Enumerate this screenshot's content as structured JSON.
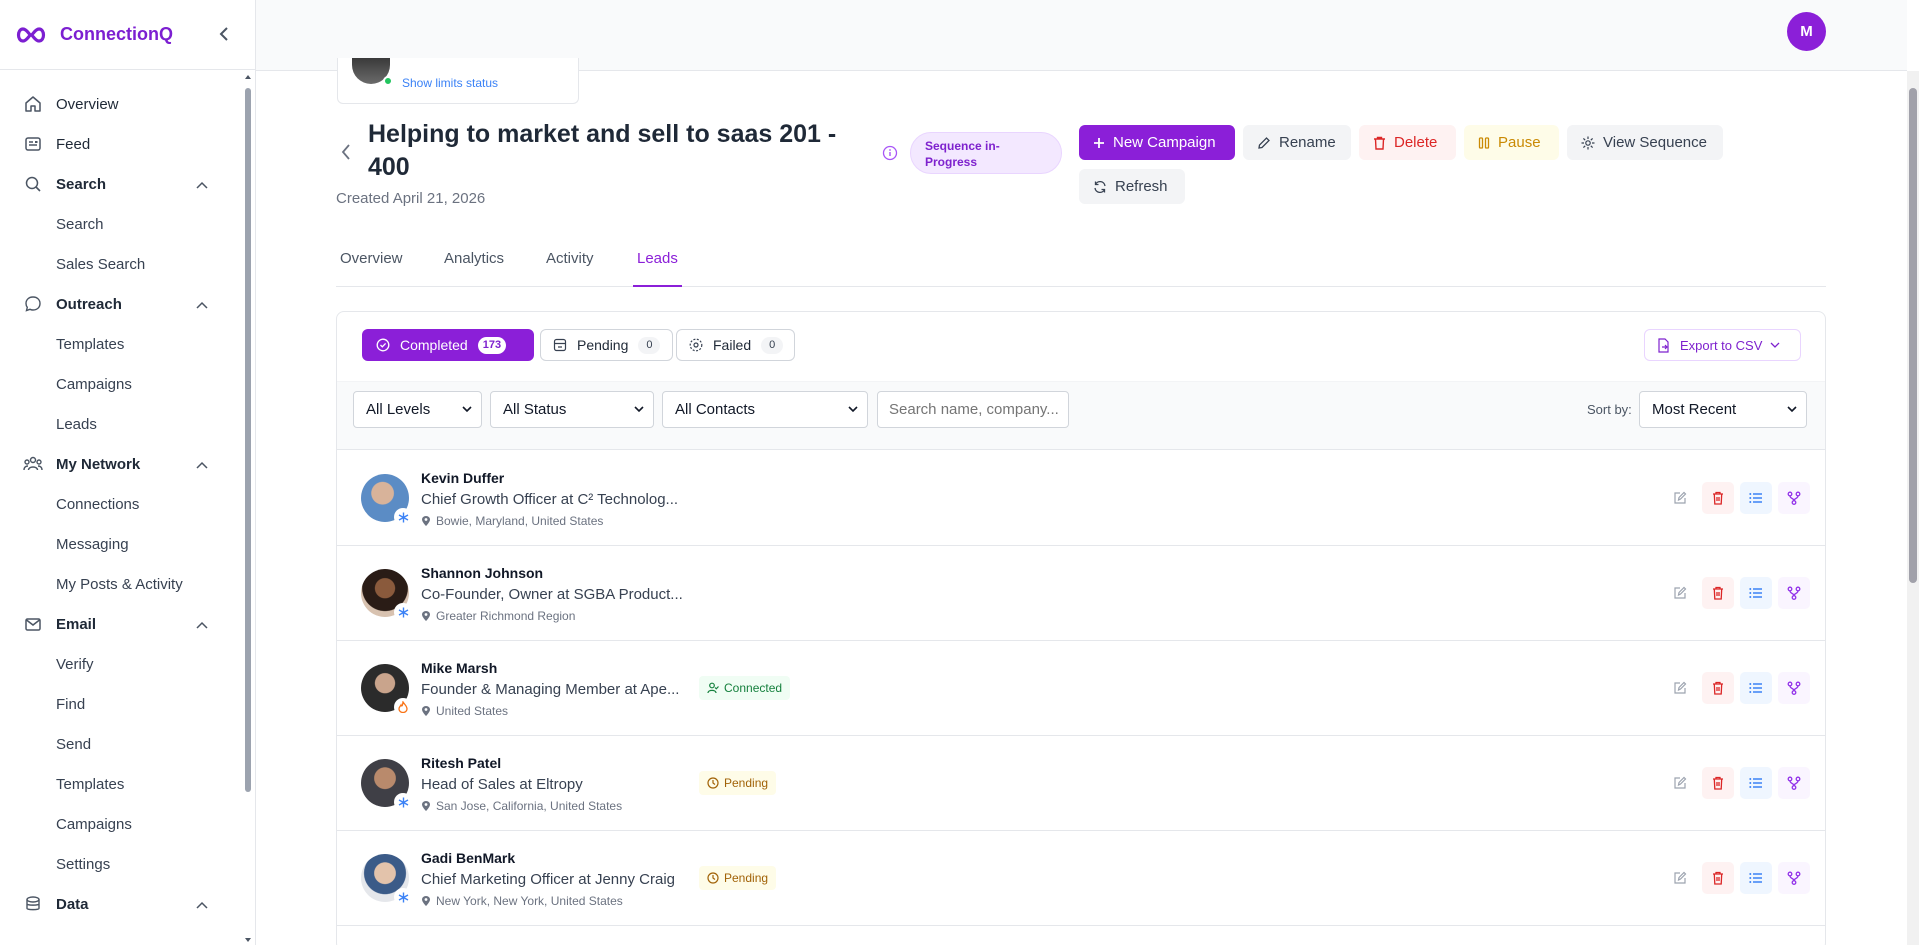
{
  "brand": {
    "name": "ConnectionQ"
  },
  "sidebar": {
    "items": [
      {
        "label": "Overview",
        "icon": "home-icon",
        "type": "item"
      },
      {
        "label": "Feed",
        "icon": "feed-icon",
        "type": "item"
      },
      {
        "label": "Search",
        "icon": "search-icon",
        "type": "section",
        "children": [
          "Search",
          "Sales Search"
        ]
      },
      {
        "label": "Outreach",
        "icon": "chat-icon",
        "type": "section",
        "children": [
          "Templates",
          "Campaigns",
          "Leads"
        ]
      },
      {
        "label": "My Network",
        "icon": "network-icon",
        "type": "section",
        "children": [
          "Connections",
          "Messaging",
          "My Posts & Activity"
        ]
      },
      {
        "label": "Email",
        "icon": "mail-icon",
        "type": "section",
        "children": [
          "Verify",
          "Find",
          "Send",
          "Templates",
          "Campaigns",
          "Settings"
        ]
      },
      {
        "label": "Data",
        "icon": "database-icon",
        "type": "section",
        "children": []
      }
    ]
  },
  "user": {
    "initial": "M"
  },
  "account": {
    "limits_link": "Show limits status"
  },
  "campaign": {
    "title": "Helping to market and sell to saas 201 - 400",
    "created": "Created April 21, 2026",
    "status_badge": "Sequence in-Progress"
  },
  "actions": {
    "new_campaign": "New Campaign",
    "rename": "Rename",
    "delete": "Delete",
    "pause": "Pause",
    "view_sequence": "View Sequence",
    "refresh": "Refresh"
  },
  "tabs": [
    "Overview",
    "Analytics",
    "Activity",
    "Leads"
  ],
  "active_tab": "Leads",
  "segments": {
    "completed": {
      "label": "Completed",
      "count": "173"
    },
    "pending": {
      "label": "Pending",
      "count": "0"
    },
    "failed": {
      "label": "Failed",
      "count": "0"
    }
  },
  "export_label": "Export to CSV",
  "filters": {
    "levels": "All Levels",
    "status": "All Status",
    "contacts": "All Contacts",
    "search_placeholder": "Search name, company...",
    "sort_label": "Sort by:",
    "sort_value": "Most Recent"
  },
  "leads": [
    {
      "name": "Kevin Duffer",
      "headline": "Chief Growth Officer at C² Technolog...",
      "location": "Bowie, Maryland, United States",
      "status": "",
      "badge": "snow"
    },
    {
      "name": "Shannon Johnson",
      "headline": "Co-Founder, Owner at SGBA Product...",
      "location": "Greater Richmond Region",
      "status": "",
      "badge": "snow"
    },
    {
      "name": "Mike Marsh",
      "headline": "Founder & Managing Member at Ape...",
      "location": "United States",
      "status": "Connected",
      "badge": "fire"
    },
    {
      "name": "Ritesh Patel",
      "headline": "Head of Sales at Eltropy",
      "location": "San Jose, California, United States",
      "status": "Pending",
      "badge": "snow"
    },
    {
      "name": "Gadi BenMark",
      "headline": "Chief Marketing Officer at Jenny Craig",
      "location": "New York, New York, United States",
      "status": "Pending",
      "badge": "snow"
    }
  ],
  "colors": {
    "brand": "#8b1fd8",
    "danger": "#dc2626",
    "warning": "#ca8a04",
    "success": "#15803d"
  }
}
